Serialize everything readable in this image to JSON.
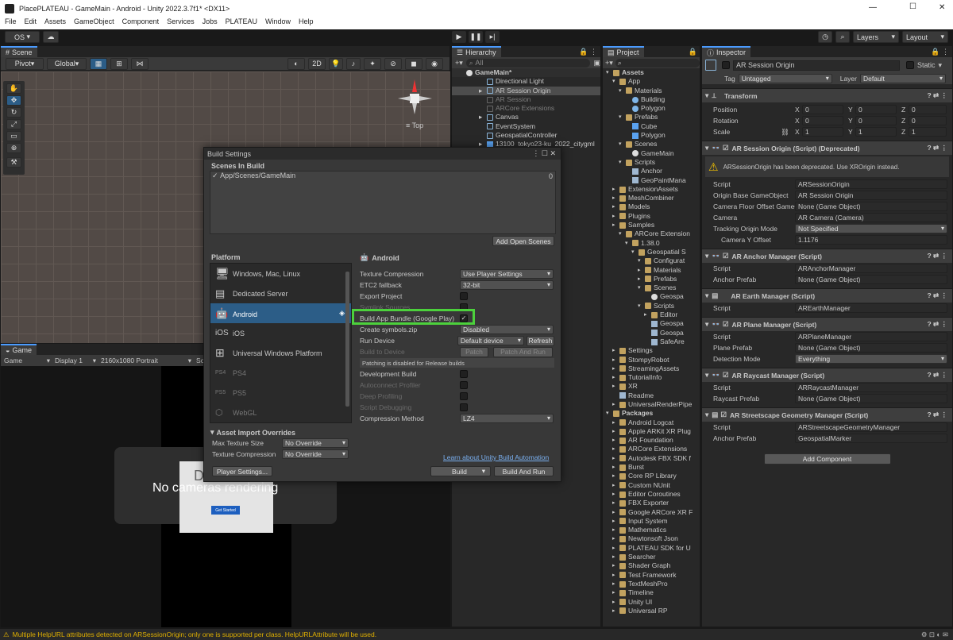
{
  "window": {
    "title": "PlacePLATEAU - GameMain - Android - Unity 2022.3.7f1* <DX11>",
    "min": "—",
    "max": "☐",
    "close": "✕"
  },
  "menu": [
    "File",
    "Edit",
    "Assets",
    "GameObject",
    "Component",
    "Services",
    "Jobs",
    "PLATEAU",
    "Window",
    "Help"
  ],
  "toolbar": {
    "account": "OS",
    "layers": "Layers",
    "layout": "Layout"
  },
  "scene": {
    "tab": "Scene",
    "pivot": "Pivot",
    "global": "Global",
    "mode2d": "2D",
    "view": "Top"
  },
  "game": {
    "tab": "Game",
    "view": "Game",
    "display": "Display 1",
    "resolution": "2160x1080 Portrait",
    "scale": "Sca",
    "no_camera": "No cameras rendering",
    "overlay": "D",
    "get_started": "Get Started"
  },
  "hierarchy": {
    "tab": "Hierarchy",
    "search": "All",
    "items": [
      "GameMain*",
      "Directional Light",
      "AR Session Origin",
      "AR Session",
      "ARCore Extensions",
      "Canvas",
      "EventSystem",
      "GeospatialController",
      "13100_tokyo23-ku_2022_citygml"
    ]
  },
  "project": {
    "tab": "Project",
    "items": [
      "Assets",
      "App",
      "Materials",
      "Building",
      "Polygon",
      "Prefabs",
      "Cube",
      "Polygon",
      "Scenes",
      "GameMain",
      "Scripts",
      "Anchor",
      "GeoPaintMana",
      "ExtensionAssets",
      "MeshCombiner",
      "Models",
      "Plugins",
      "Samples",
      "ARCore Extension",
      "1.38.0",
      "Geospatial S",
      "Configurat",
      "Materials",
      "Prefabs",
      "Scenes",
      "Geospa",
      "Scripts",
      "Editor",
      "Geospa",
      "Geospa",
      "SafeAre",
      "Settings",
      "StompyRobot",
      "StreamingAssets",
      "TutorialInfo",
      "XR",
      "Readme",
      "UniversalRenderPipe",
      "Packages",
      "Android Logcat",
      "Apple ARKit XR Plug",
      "AR Foundation",
      "ARCore Extensions",
      "Autodesk FBX SDK f",
      "Burst",
      "Core RP Library",
      "Custom NUnit",
      "Editor Coroutines",
      "FBX Exporter",
      "Google ARCore XR F",
      "Input System",
      "Mathematics",
      "Newtonsoft Json",
      "PLATEAU SDK for U",
      "Searcher",
      "Shader Graph",
      "Test Framework",
      "TextMeshPro",
      "Timeline",
      "Unity UI",
      "Universal RP"
    ]
  },
  "inspector": {
    "tab": "Inspector",
    "object_name": "AR Session Origin",
    "static": "Static",
    "tag_label": "Tag",
    "tag": "Untagged",
    "layer_label": "Layer",
    "layer": "Default",
    "transform": {
      "title": "Transform",
      "position": "Position",
      "rotation": "Rotation",
      "scale": "Scale",
      "px": "0",
      "py": "0",
      "pz": "0",
      "rx": "0",
      "ry": "0",
      "rz": "0",
      "sx": "1",
      "sy": "1",
      "sz": "1",
      "x": "X",
      "y": "Y",
      "z": "Z"
    },
    "aso": {
      "title": "AR Session Origin (Script) (Deprecated)",
      "warning": "ARSessionOrigin has been deprecated. Use XROrigin instead.",
      "script_label": "Script",
      "script": "ARSessionOrigin",
      "origin_label": "Origin Base GameObject",
      "origin": "AR Session Origin",
      "floor_label": "Camera Floor Offset GameOb",
      "floor": "None (Game Object)",
      "camera_label": "Camera",
      "camera": "AR Camera (Camera)",
      "tracking_label": "Tracking Origin Mode",
      "tracking": "Not Specified",
      "cam_y_label": "Camera Y Offset",
      "cam_y": "1.1176"
    },
    "anchor": {
      "title": "AR Anchor Manager (Script)",
      "script_label": "Script",
      "script": "ARAnchorManager",
      "prefab_label": "Anchor Prefab",
      "prefab": "None (Game Object)"
    },
    "earth": {
      "title": "AR Earth Manager (Script)",
      "script_label": "Script",
      "script": "AREarthManager"
    },
    "plane": {
      "title": "AR Plane Manager (Script)",
      "script_label": "Script",
      "script": "ARPlaneManager",
      "prefab_label": "Plane Prefab",
      "prefab": "None (Game Object)",
      "detect_label": "Detection Mode",
      "detect": "Everything"
    },
    "raycast": {
      "title": "AR Raycast Manager (Script)",
      "script_label": "Script",
      "script": "ARRaycastManager",
      "prefab_label": "Raycast Prefab",
      "prefab": "None (Game Object)"
    },
    "street": {
      "title": "AR Streetscape Geometry Manager (Script)",
      "script_label": "Script",
      "script": "ARStreetscapeGeometryManager",
      "prefab_label": "Anchor Prefab",
      "prefab": "GeospatialMarker"
    },
    "add_component": "Add Component"
  },
  "build": {
    "title": "Build Settings",
    "scenes_label": "Scenes In Build",
    "scene": "App/Scenes/GameMain",
    "scene_index": "0",
    "add_open": "Add Open Scenes",
    "platform_label": "Platform",
    "platforms": [
      "Windows, Mac, Linux",
      "Dedicated Server",
      "Android",
      "iOS",
      "Universal Windows Platform",
      "PS4",
      "PS5",
      "WebGL"
    ],
    "android_title": "Android",
    "tex_label": "Texture Compression",
    "tex": "Use Player Settings",
    "etc_label": "ETC2 fallback",
    "etc": "32-bit",
    "export_label": "Export Project",
    "symlink_label": "Symlink Sources",
    "bundle_label": "Build App Bundle (Google Play)",
    "symbols_label": "Create symbols.zip",
    "symbols": "Disabled",
    "run_label": "Run Device",
    "run": "Default device",
    "refresh": "Refresh",
    "build_to_label": "Build to Device",
    "patch": "Patch",
    "patch_run": "Patch And Run",
    "patch_note": "Patching is disabled for Release builds",
    "dev_label": "Development Build",
    "autoconnect_label": "Autoconnect Profiler",
    "deep_label": "Deep Profiling",
    "debug_label": "Script Debugging",
    "comp_label": "Compression Method",
    "comp": "LZ4",
    "overrides_label": "Asset Import Overrides",
    "max_tex_label": "Max Texture Size",
    "max_tex": "No Override",
    "tex2_label": "Texture Compression",
    "tex2": "No Override",
    "learn": "Learn about Unity Build Automation",
    "player": "Player Settings...",
    "build_btn": "Build",
    "build_run": "Build And Run"
  },
  "status": {
    "text": "Multiple HelpURL attributes detected on ARSessionOrigin; only one is supported per class. HelpURLAttribute will be used."
  },
  "colors": {
    "highlight": "#4cd13c",
    "selection": "#2c5d87"
  }
}
